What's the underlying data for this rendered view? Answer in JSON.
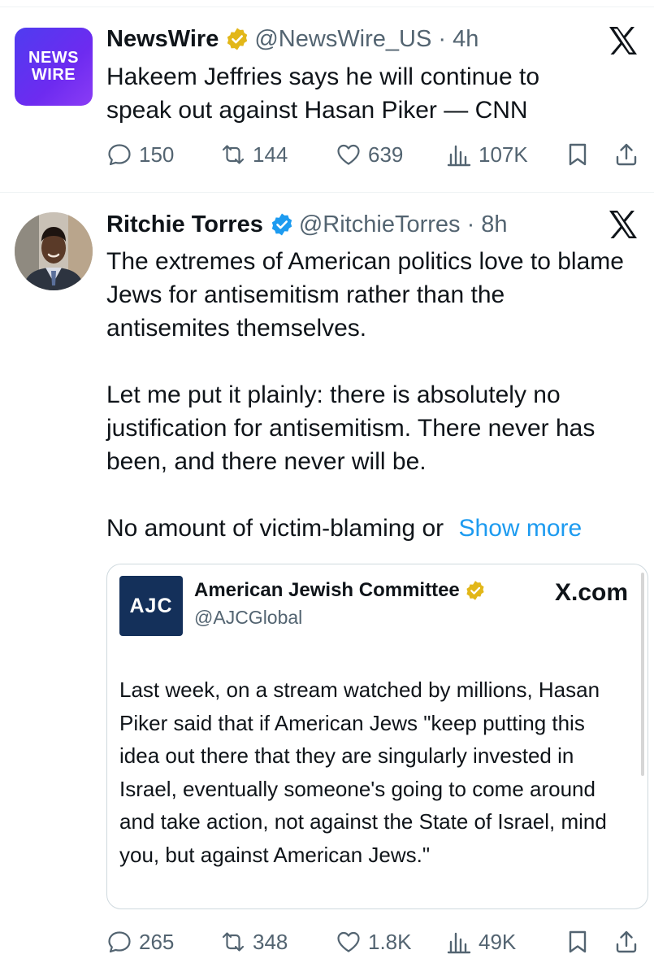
{
  "posts": [
    {
      "avatar_text": [
        "NEWS",
        "WIRE"
      ],
      "name": "NewsWire",
      "handle_time": "@NewsWire_US · 4h",
      "text": "Hakeem Jeffries says he will continue to speak out against Hasan Piker — CNN",
      "replies": "150",
      "reposts": "144",
      "likes": "639",
      "views": "107K"
    },
    {
      "name": "Ritchie Torres",
      "handle_time": "@RitchieTorres · 8h",
      "paragraphs": [
        "The extremes of American politics love to blame Jews for antisemitism rather than the antisemites themselves.",
        "Let me put it plainly: there is absolutely no justification for antisemitism. There never has been, and there never will be."
      ],
      "truncated_line": "No amount of victim-blaming or",
      "show_more": "Show more",
      "replies": "265",
      "reposts": "348",
      "likes": "1.8K",
      "views": "49K",
      "quote": {
        "logo_text": "AJC",
        "name": "American Jewish Committee",
        "handle": "@AJCGlobal",
        "source": "X.com",
        "text": "Last week, on a stream watched by millions, Hasan Piker said that if American Jews \"keep putting this idea out there that they are singularly invested in Israel, eventually someone's going to come around and take action, not against the State of Israel, mind you, but against American Jews.\""
      }
    }
  ],
  "colors": {
    "text": "#0f1419",
    "secondary": "#536471",
    "link": "#1d9bf0",
    "verified_gold": "#e2b719",
    "border": "#cfd9de"
  },
  "icons": [
    "newswire-logo",
    "verified-badge-icon",
    "x-logo-icon",
    "reply-icon",
    "repost-icon",
    "like-icon",
    "views-icon",
    "bookmark-icon",
    "share-icon",
    "ajc-logo"
  ]
}
